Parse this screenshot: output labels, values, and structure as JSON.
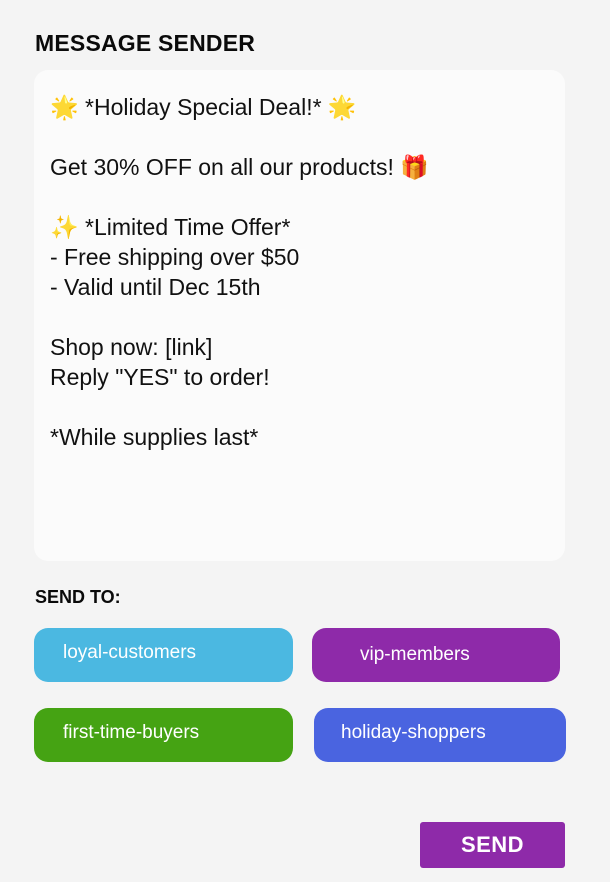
{
  "app": {
    "title": "MESSAGE SENDER"
  },
  "message": {
    "text": "🌟 *Holiday Special Deal!* 🌟\n\nGet 30% OFF on all our products! 🎁\n\n✨ *Limited Time Offer*\n- Free shipping over $50\n- Valid until Dec 15th\n\nShop now: [link]\nReply \"YES\" to order!\n\n*While supplies last*"
  },
  "recipients": {
    "label": "SEND TO:",
    "groups": [
      {
        "label": "loyal-customers",
        "color": "#4bb8e1"
      },
      {
        "label": "vip-members",
        "color": "#8e2aa9"
      },
      {
        "label": "first-time-buyers",
        "color": "#45a313"
      },
      {
        "label": "holiday-shoppers",
        "color": "#4a64e0"
      }
    ]
  },
  "actions": {
    "send_label": "SEND",
    "send_color": "#8e2aa9"
  }
}
